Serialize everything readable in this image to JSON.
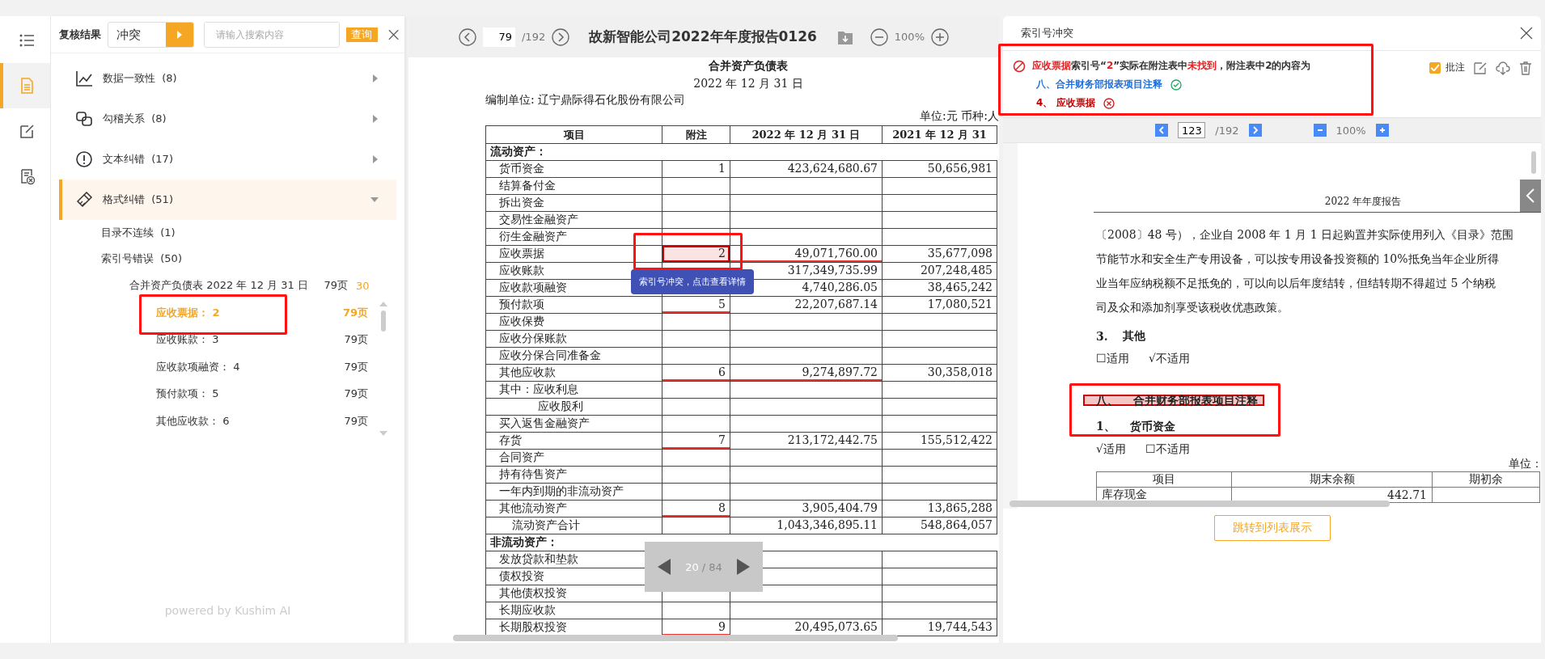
{
  "rail": {
    "items": [
      {
        "selected": false
      },
      {
        "selected": true
      },
      {
        "selected": false
      },
      {
        "selected": false
      }
    ]
  },
  "review": {
    "title": "复核结果",
    "filter": {
      "value": "冲突"
    },
    "search": {
      "placeholder": "请输入搜索内容",
      "button": "查询"
    },
    "categories": [
      {
        "label": "数据一致性",
        "count": "(8)",
        "expanded": false
      },
      {
        "label": "勾稽关系",
        "count": "(8)",
        "expanded": false
      },
      {
        "label": "文本纠错",
        "count": "(17)",
        "expanded": false
      },
      {
        "label": "格式纠错",
        "count": "(51)",
        "expanded": true,
        "children": [
          {
            "label": "目录不连续",
            "count": "(1)"
          },
          {
            "label": "索引号错误",
            "count": "(50)",
            "children": [
              {
                "label": "合并资产负债表 2022 年 12 月 31 日",
                "page": "79页",
                "badge": "30",
                "children": [
                  {
                    "label": "应收票据：",
                    "value": "2",
                    "page": "79页",
                    "selected": true
                  },
                  {
                    "label": "应收账款：",
                    "value": "3",
                    "page": "79页",
                    "selected": false
                  },
                  {
                    "label": "应收款项融资：",
                    "value": "4",
                    "page": "79页",
                    "selected": false
                  },
                  {
                    "label": "预付款项：",
                    "value": "5",
                    "page": "79页",
                    "selected": false
                  },
                  {
                    "label": "其他应收款：",
                    "value": "6",
                    "page": "79页",
                    "selected": false
                  }
                ]
              }
            ]
          }
        ]
      }
    ],
    "footer": "powered by Kushim AI"
  },
  "viewer": {
    "page": "79",
    "total": "/192",
    "title": "故新智能公司2022年年度报告0126",
    "zoom": "100%",
    "document": {
      "title": "合并资产负债表",
      "date": "2022 年 12 月 31 日",
      "company": "编制单位: 辽宁鼎际得石化股份有限公司",
      "unit": "单位:元  币种:人",
      "columns": [
        "项目",
        "附注",
        "2022 年 12 月 31 日",
        "2021 年 12 月 31"
      ],
      "rows": [
        {
          "kind": "section",
          "item": "流动资产："
        },
        {
          "kind": "line",
          "item": "货币资金",
          "note": "1",
          "current": "423,624,680.67",
          "prior": "50,656,981"
        },
        {
          "kind": "line",
          "item": "结算备付金"
        },
        {
          "kind": "line",
          "item": "拆出资金"
        },
        {
          "kind": "line",
          "item": "交易性金融资产"
        },
        {
          "kind": "line",
          "item": "衍生金融资产"
        },
        {
          "kind": "line",
          "item": "应收票据",
          "note": "2",
          "current": "49,071,760.00",
          "prior": "35,677,098",
          "highlighted": true,
          "flag_amount": true
        },
        {
          "kind": "line",
          "item": "应收账款",
          "current": "317,349,735.99",
          "prior": "207,248,485"
        },
        {
          "kind": "line",
          "item": "应收款项融资",
          "current": "4,740,286.05",
          "prior": "38,465,242"
        },
        {
          "kind": "line",
          "item": "预付款项",
          "note": "5",
          "current": "22,207,687.14",
          "prior": "17,080,521",
          "flag_note": true
        },
        {
          "kind": "line",
          "item": "应收保费"
        },
        {
          "kind": "line",
          "item": "应收分保账款"
        },
        {
          "kind": "line",
          "item": "应收分保合同准备金"
        },
        {
          "kind": "line",
          "item": "其他应收款",
          "note": "6",
          "current": "9,274,897.72",
          "prior": "30,358,018",
          "flag_note": true,
          "flag_amount": true
        },
        {
          "kind": "line",
          "item": "其中：应收利息"
        },
        {
          "kind": "sub",
          "item": "应收股利"
        },
        {
          "kind": "line",
          "item": "买入返售金融资产"
        },
        {
          "kind": "line",
          "item": "存货",
          "note": "7",
          "current": "213,172,442.75",
          "prior": "155,512,422",
          "flag_note": true
        },
        {
          "kind": "line",
          "item": "合同资产"
        },
        {
          "kind": "line",
          "item": "持有待售资产"
        },
        {
          "kind": "line",
          "item": "一年内到期的非流动资产"
        },
        {
          "kind": "line",
          "item": "其他流动资产",
          "note": "8",
          "current": "3,905,404.79",
          "prior": "13,865,288",
          "flag_note": true
        },
        {
          "kind": "total",
          "item": "流动资产合计",
          "current": "1,043,346,895.11",
          "prior": "548,864,057"
        },
        {
          "kind": "section",
          "item": "非流动资产："
        },
        {
          "kind": "line",
          "item": "发放贷款和垫款"
        },
        {
          "kind": "line",
          "item": "债权投资"
        },
        {
          "kind": "line",
          "item": "其他债权投资"
        },
        {
          "kind": "line",
          "item": "长期应收款"
        },
        {
          "kind": "line",
          "item": "长期股权投资",
          "note": "9",
          "current": "20,495,073.65",
          "prior": "19,744,543",
          "flag_note": true
        }
      ]
    },
    "tooltip": "索引号冲突，点击查看详情",
    "pager": {
      "current": "20",
      "separator": "/",
      "total": "84"
    }
  },
  "detail": {
    "title": "索引号冲突",
    "message": [
      {
        "text": "应收票据",
        "alert": true
      },
      {
        "text": "索引号“",
        "alert": false
      },
      {
        "text": "2",
        "alert": true
      },
      {
        "text": "”实际在附注表中",
        "alert": false
      },
      {
        "text": "未找到",
        "alert": true
      },
      {
        "text": "，附注表中2的内容为",
        "alert": false
      }
    ],
    "matches": [
      {
        "text": "八、合并财务部报表项目注释",
        "found": true
      },
      {
        "text": "4、 应收票据",
        "found": false
      }
    ],
    "annotate": {
      "label": "批注",
      "checked": true
    },
    "viewer": {
      "page": "123",
      "total": "/192",
      "zoom": "100%"
    },
    "document": {
      "header": "2022 年年度报告",
      "lines": [
        "〔2008〕48 号），企业自 2008 年 1 月 1 日起购置并实际使用列入《目录》范围",
        "节能节水和安全生产专用设备，可以按专用设备投资额的 10%抵免当年企业所得",
        "业当年应纳税额不足抵免的，可以向以后年度结转，但结转期不得超过 5 个纳税",
        "司及众和添加剂享受该税收优惠政策。"
      ],
      "blocks": [
        {
          "kind": "heading",
          "number": "3.",
          "text": "其他"
        },
        {
          "kind": "options",
          "options": [
            "☐适用",
            "√不适用"
          ]
        },
        {
          "kind": "heading",
          "number": "八、",
          "text": "合并财务部报表项目注释",
          "highlighted": true
        },
        {
          "kind": "heading",
          "number": "1、",
          "text": "货币资金"
        },
        {
          "kind": "options",
          "options": [
            "√适用",
            "☐不适用"
          ]
        }
      ],
      "unit": "单位：",
      "columns": [
        "项目",
        "期末余额",
        "期初余"
      ],
      "rows": [
        [
          "库存现金",
          "442.71",
          ""
        ]
      ]
    },
    "button": "跳转到列表展示"
  }
}
